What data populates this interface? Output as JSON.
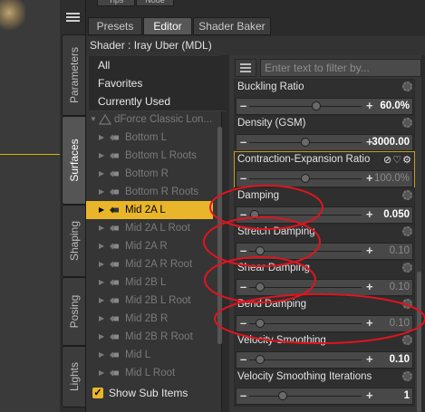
{
  "top_tabs_partial": [
    "Tips",
    "Node"
  ],
  "side_tabs": [
    {
      "label": "Parameters",
      "active": false
    },
    {
      "label": "Surfaces",
      "active": true
    },
    {
      "label": "Shaping",
      "active": false
    },
    {
      "label": "Posing",
      "active": false
    },
    {
      "label": "Lights",
      "active": false
    }
  ],
  "tabs": [
    {
      "label": "Presets",
      "active": false
    },
    {
      "label": "Editor",
      "active": true
    },
    {
      "label": "Shader Baker",
      "active": false
    }
  ],
  "shader_label": "Shader : Iray Uber (MDL)",
  "filter": {
    "placeholder": "Enter text to filter by..."
  },
  "list": {
    "all": "All",
    "favorites": "Favorites",
    "currently_used": "Currently Used",
    "group": "dForce Classic Lon...",
    "items": [
      "Bottom L",
      "Bottom L Roots",
      "Bottom R",
      "Bottom R Roots",
      "Mid 2A L",
      "Mid 2A L Root",
      "Mid 2A R",
      "Mid 2A R Root",
      "Mid 2B L",
      "Mid 2B L Root",
      "Mid 2B R",
      "Mid 2B R Root",
      "Mid L",
      "Mid L Root"
    ],
    "selected": "Mid 2A L",
    "show_sub_items": "Show Sub Items"
  },
  "properties": [
    {
      "label": "Buckling Ratio",
      "value": "60.0%",
      "level": 0.6,
      "dim": false
    },
    {
      "label": "Density (GSM)",
      "value": "3000.00",
      "level": 0.5,
      "dim": false
    },
    {
      "label": "Contraction-Expansion Ratio",
      "value": "100.0%",
      "level": 0.5,
      "dim": true
    },
    {
      "label": "Damping",
      "value": "0.050",
      "level": 0.05,
      "dim": false
    },
    {
      "label": "Stretch Damping",
      "value": "0.10",
      "level": 0.1,
      "dim": true
    },
    {
      "label": "Shear Damping",
      "value": "0.10",
      "level": 0.1,
      "dim": true
    },
    {
      "label": "Bend Damping",
      "value": "0.10",
      "level": 0.1,
      "dim": true
    },
    {
      "label": "Velocity Smoothing",
      "value": "0.10",
      "level": 0.1,
      "dim": false
    },
    {
      "label": "Velocity Smoothing Iterations",
      "value": "1",
      "level": 0.3,
      "dim": false
    }
  ],
  "colors": {
    "selection": "#e9b52a",
    "annotation": "#e0141e",
    "highlight_border": "#c99c1f"
  }
}
